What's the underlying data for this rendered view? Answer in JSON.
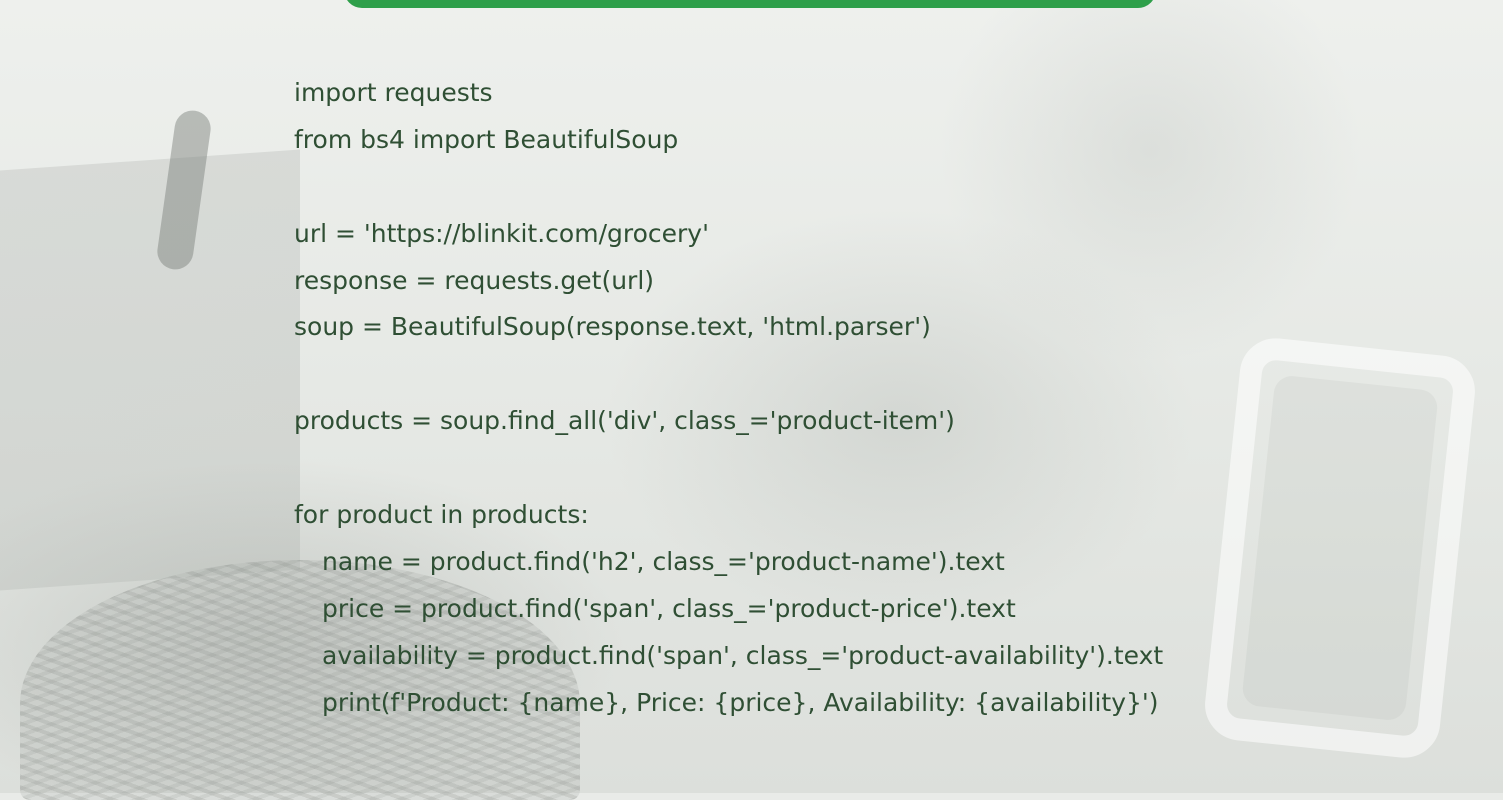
{
  "code": {
    "lines": [
      "import requests",
      "from bs4 import BeautifulSoup",
      "",
      "url = 'https://blinkit.com/grocery'",
      "response = requests.get(url)",
      "soup = BeautifulSoup(response.text, 'html.parser')",
      "",
      "products = soup.find_all('div', class_='product-item')",
      "",
      "for product in products:",
      "name = product.find('h2', class_='product-name').text",
      "price = product.find('span', class_='product-price').text",
      "availability = product.find('span', class_='product-availability').text",
      "print(f'Product: {name}, Price: {price}, Availability: {availability}')"
    ]
  },
  "colors": {
    "banner": "#2e9f4a",
    "code_text": "#2f4f34"
  },
  "icons": {
    "phone": "phone-frame-icon"
  }
}
